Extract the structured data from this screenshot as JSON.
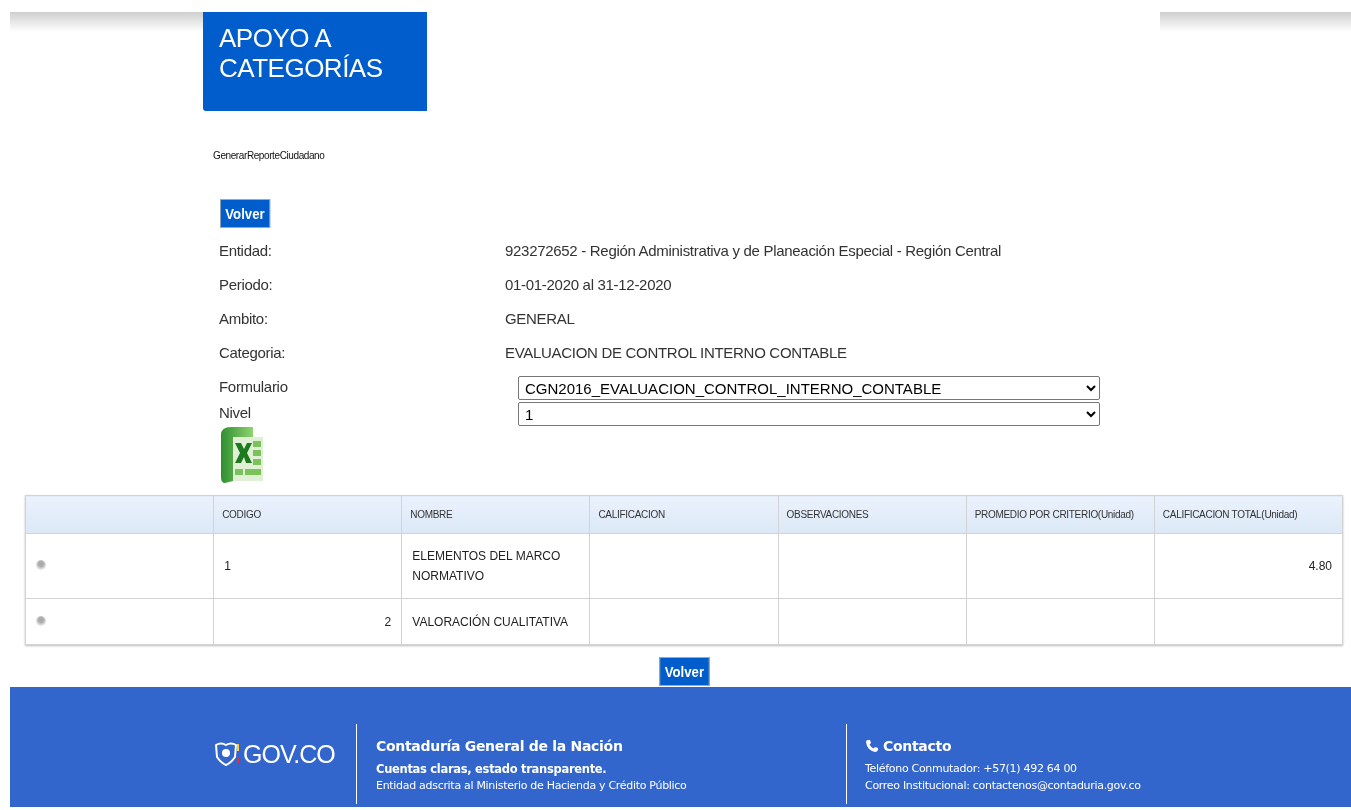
{
  "header": {
    "title": "APOYO A CATEGORÍAS"
  },
  "report_name": "GenerarReporteCiudadano",
  "back_button_top": "Volver",
  "fields": [
    {
      "label": "Entidad:",
      "value": "923272652 - Región Administrativa y de Planeación Especial - Región Central",
      "kind": "text"
    },
    {
      "label": "Periodo:",
      "value": "01-01-2020 al 31-12-2020",
      "kind": "text"
    },
    {
      "label": "Ambito:",
      "value": "GENERAL",
      "kind": "text"
    },
    {
      "label": "Categoria:",
      "value": "EVALUACION DE CONTROL INTERNO CONTABLE",
      "kind": "text"
    },
    {
      "label": "Formulario",
      "value": "CGN2016_EVALUACION_CONTROL_INTERNO_CONTABLE",
      "kind": "select"
    },
    {
      "label": "Nivel",
      "value": "1",
      "kind": "select"
    }
  ],
  "table": {
    "columns": [
      "CODIGO",
      "NOMBRE",
      "CALIFICACION",
      "OBSERVACIONES",
      "PROMEDIO POR CRITERIO(Unidad)",
      "CALIFICACION TOTAL(Unidad)"
    ],
    "rows": [
      {
        "selected": false,
        "kind": "group",
        "codigo": "1",
        "nombre": "ELEMENTOS DEL MARCO NORMATIVO",
        "calificacion_total": "4.80"
      },
      {
        "selected": false,
        "kind": "item",
        "codigo": "2",
        "nombre": "VALORACIÓN CUALITATIVA"
      }
    ]
  },
  "back_button_bottom": "Volver",
  "footer": {
    "logo": "GOV.CO",
    "org_title": "Contaduría General de la Nación",
    "slogan": "Cuentas claras, estado transparente.",
    "org_note": "Entidad adscrita al Ministerio de Hacienda y Crédito Público",
    "contact_title": "Contacto",
    "contact_lines": [
      "Teléfono Conmutador: +57(1) 492 64 00",
      "Correo Institucional: contactenos@contaduria.gov.co"
    ]
  }
}
